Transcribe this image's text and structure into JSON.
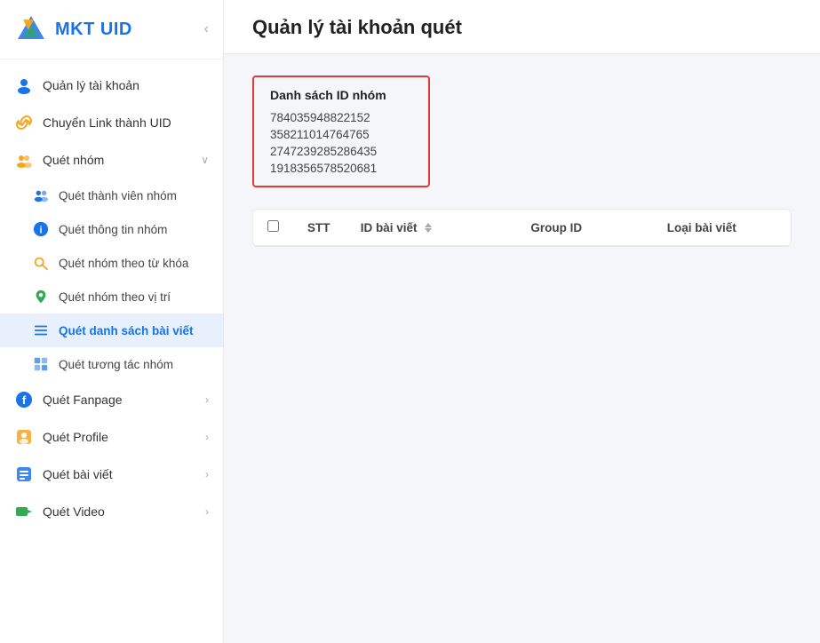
{
  "logo": {
    "text": "MKT UID",
    "collapse_icon": "‹"
  },
  "sidebar": {
    "items": [
      {
        "id": "quan-ly-tai-khoan",
        "label": "Quản lý tài khoản",
        "icon": "person",
        "type": "top",
        "hasArrow": false
      },
      {
        "id": "chuyen-link",
        "label": "Chuyển Link thành UID",
        "icon": "link",
        "type": "top",
        "hasArrow": false
      },
      {
        "id": "quet-nhom",
        "label": "Quét nhóm",
        "icon": "group",
        "type": "parent",
        "hasArrow": true,
        "expanded": true
      },
      {
        "id": "quet-thanh-vien",
        "label": "Quét thành viên nhóm",
        "icon": "members",
        "type": "sub"
      },
      {
        "id": "quet-thong-tin",
        "label": "Quét thông tin nhóm",
        "icon": "info",
        "type": "sub"
      },
      {
        "id": "quet-theo-tu-khoa",
        "label": "Quét nhóm theo từ khóa",
        "icon": "key",
        "type": "sub"
      },
      {
        "id": "quet-theo-vi-tri",
        "label": "Quét nhóm theo vị trí",
        "icon": "location",
        "type": "sub"
      },
      {
        "id": "quet-danh-sach-bai-viet",
        "label": "Quét danh sách bài viết",
        "icon": "list",
        "type": "sub",
        "active": true
      },
      {
        "id": "quet-tuong-tac-nhom",
        "label": "Quét tương tác nhóm",
        "icon": "interaction",
        "type": "sub"
      },
      {
        "id": "quet-fanpage",
        "label": "Quét Fanpage",
        "icon": "fanpage",
        "type": "top",
        "hasArrow": true
      },
      {
        "id": "quet-profile",
        "label": "Quét Profile",
        "icon": "profile",
        "type": "top",
        "hasArrow": true
      },
      {
        "id": "quet-bai-viet",
        "label": "Quét bài viết",
        "icon": "post",
        "type": "top",
        "hasArrow": true
      },
      {
        "id": "quet-video",
        "label": "Quét Video",
        "icon": "video",
        "type": "top",
        "hasArrow": true
      }
    ]
  },
  "main": {
    "page_title": "Quản lý tài khoản quét",
    "group_id_box": {
      "title": "Danh sách ID nhóm",
      "ids": [
        "784035948822152",
        "358211014764765",
        "2747239285286435",
        "1918356578520681"
      ]
    },
    "table": {
      "columns": [
        {
          "id": "checkbox",
          "label": ""
        },
        {
          "id": "stt",
          "label": "STT"
        },
        {
          "id": "id-bai-viet",
          "label": "ID bài viết",
          "sortable": true
        },
        {
          "id": "group-id",
          "label": "Group ID"
        },
        {
          "id": "loai-bai-viet",
          "label": "Loại bài viết"
        }
      ],
      "rows": []
    }
  }
}
